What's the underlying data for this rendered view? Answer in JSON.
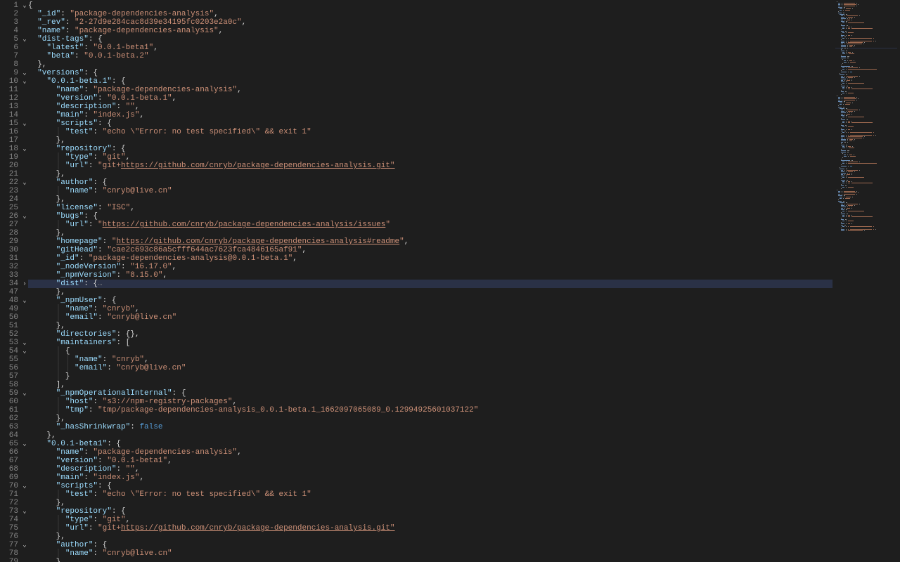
{
  "file_content": {
    "_id": "package-dependencies-analysis",
    "_rev": "2-27d9e284cac8d39e34195fc0203e2a0c",
    "name": "package-dependencies-analysis",
    "dist-tags": {
      "latest": "0.0.1-beta1",
      "beta": "0.0.1-beta.2"
    },
    "versions": {
      "0.0.1-beta.1": {
        "name": "package-dependencies-analysis",
        "version": "0.0.1-beta.1",
        "description": "",
        "main": "index.js",
        "scripts": {
          "test": "echo \\\"Error: no test specified\\\" && exit 1"
        },
        "repository": {
          "type": "git",
          "url": "git+https://github.com/cnryb/package-dependencies-analysis.git",
          "url_prefix": "git+",
          "url_link": "https://github.com/cnryb/package-dependencies-analysis.git"
        },
        "author": {
          "name": "cnryb@live.cn"
        },
        "license": "ISC",
        "bugs": {
          "url": "https://github.com/cnryb/package-dependencies-analysis/issues"
        },
        "homepage": "https://github.com/cnryb/package-dependencies-analysis#readme",
        "gitHead": "cae2c693c86a5cfff644ac7623fca4846165af91",
        "_id": "package-dependencies-analysis@0.0.1-beta.1",
        "_nodeVersion": "16.17.0",
        "_npmVersion": "8.15.0",
        "dist_folded": true,
        "_npmUser": {
          "name": "cnryb",
          "email": "cnryb@live.cn"
        },
        "directories": {},
        "maintainers": [
          {
            "name": "cnryb",
            "email": "cnryb@live.cn"
          }
        ],
        "_npmOperationalInternal": {
          "host": "s3://npm-registry-packages",
          "tmp": "tmp/package-dependencies-analysis_0.0.1-beta.1_1662097065089_0.12994925601037122"
        },
        "_hasShrinkwrap": false
      },
      "0.0.1-beta1": {
        "name": "package-dependencies-analysis",
        "version": "0.0.1-beta1",
        "description": "",
        "main": "index.js",
        "scripts": {
          "test": "echo \\\"Error: no test specified\\\" && exit 1"
        },
        "repository": {
          "type": "git",
          "url": "git+https://github.com/cnryb/package-dependencies-analysis.git",
          "url_prefix": "git+",
          "url_link": "https://github.com/cnryb/package-dependencies-analysis.git"
        },
        "author": {
          "name": "cnryb@live.cn"
        }
      }
    }
  },
  "editor": {
    "current_line_highlight": 34,
    "folded_regions": [
      {
        "start": 34,
        "end": 47,
        "display": "dist"
      }
    ],
    "colors": {
      "background": "#1e1e1e",
      "gutter_fg": "#858585",
      "key": "#9cdcfe",
      "string": "#ce9178",
      "punctuation": "#d4d4d4",
      "boolean": "#569cd6",
      "highlight_bg": "#2a3146"
    }
  },
  "lines": [
    {
      "n": 1,
      "fold": "open",
      "i": 0,
      "t": [
        [
          "p",
          "{"
        ]
      ]
    },
    {
      "n": 2,
      "i": 1,
      "t": [
        [
          "k",
          "\"_id\""
        ],
        [
          "p",
          ": "
        ],
        [
          "s",
          "\"package-dependencies-analysis\""
        ],
        [
          "p",
          ","
        ]
      ]
    },
    {
      "n": 3,
      "i": 1,
      "t": [
        [
          "k",
          "\"_rev\""
        ],
        [
          "p",
          ": "
        ],
        [
          "s",
          "\"2-27d9e284cac8d39e34195fc0203e2a0c\""
        ],
        [
          "p",
          ","
        ]
      ]
    },
    {
      "n": 4,
      "i": 1,
      "t": [
        [
          "k",
          "\"name\""
        ],
        [
          "p",
          ": "
        ],
        [
          "s",
          "\"package-dependencies-analysis\""
        ],
        [
          "p",
          ","
        ]
      ]
    },
    {
      "n": 5,
      "fold": "open",
      "i": 1,
      "t": [
        [
          "k",
          "\"dist-tags\""
        ],
        [
          "p",
          ": {"
        ]
      ]
    },
    {
      "n": 6,
      "i": 2,
      "t": [
        [
          "k",
          "\"latest\""
        ],
        [
          "p",
          ": "
        ],
        [
          "s",
          "\"0.0.1-beta1\""
        ],
        [
          "p",
          ","
        ]
      ]
    },
    {
      "n": 7,
      "i": 2,
      "t": [
        [
          "k",
          "\"beta\""
        ],
        [
          "p",
          ": "
        ],
        [
          "s",
          "\"0.0.1-beta.2\""
        ]
      ]
    },
    {
      "n": 8,
      "i": 1,
      "t": [
        [
          "p",
          "},"
        ]
      ]
    },
    {
      "n": 9,
      "fold": "open",
      "i": 1,
      "t": [
        [
          "k",
          "\"versions\""
        ],
        [
          "p",
          ": {"
        ]
      ]
    },
    {
      "n": 10,
      "fold": "open",
      "i": 2,
      "t": [
        [
          "k",
          "\"0.0.1-beta.1\""
        ],
        [
          "p",
          ": {"
        ]
      ]
    },
    {
      "n": 11,
      "i": 3,
      "t": [
        [
          "k",
          "\"name\""
        ],
        [
          "p",
          ": "
        ],
        [
          "s",
          "\"package-dependencies-analysis\""
        ],
        [
          "p",
          ","
        ]
      ]
    },
    {
      "n": 12,
      "i": 3,
      "t": [
        [
          "k",
          "\"version\""
        ],
        [
          "p",
          ": "
        ],
        [
          "s",
          "\"0.0.1-beta.1\""
        ],
        [
          "p",
          ","
        ]
      ]
    },
    {
      "n": 13,
      "i": 3,
      "t": [
        [
          "k",
          "\"description\""
        ],
        [
          "p",
          ": "
        ],
        [
          "s",
          "\"\""
        ],
        [
          "p",
          ","
        ]
      ]
    },
    {
      "n": 14,
      "i": 3,
      "t": [
        [
          "k",
          "\"main\""
        ],
        [
          "p",
          ": "
        ],
        [
          "s",
          "\"index.js\""
        ],
        [
          "p",
          ","
        ]
      ]
    },
    {
      "n": 15,
      "fold": "open",
      "i": 3,
      "t": [
        [
          "k",
          "\"scripts\""
        ],
        [
          "p",
          ": {"
        ]
      ]
    },
    {
      "n": 16,
      "i": 4,
      "g": 1,
      "t": [
        [
          "k",
          "\"test\""
        ],
        [
          "p",
          ": "
        ],
        [
          "s",
          "\"echo \\\"Error: no test specified\\\" && exit 1\""
        ]
      ]
    },
    {
      "n": 17,
      "i": 3,
      "t": [
        [
          "p",
          "},"
        ]
      ]
    },
    {
      "n": 18,
      "fold": "open",
      "i": 3,
      "t": [
        [
          "k",
          "\"repository\""
        ],
        [
          "p",
          ": {"
        ]
      ]
    },
    {
      "n": 19,
      "i": 4,
      "g": 1,
      "t": [
        [
          "k",
          "\"type\""
        ],
        [
          "p",
          ": "
        ],
        [
          "s",
          "\"git\""
        ],
        [
          "p",
          ","
        ]
      ]
    },
    {
      "n": 20,
      "i": 4,
      "g": 1,
      "t": [
        [
          "k",
          "\"url\""
        ],
        [
          "p",
          ": "
        ],
        [
          "s",
          "\"git+"
        ],
        [
          "u",
          "https://github.com/cnryb/package-dependencies-analysis.git\""
        ]
      ]
    },
    {
      "n": 21,
      "i": 3,
      "t": [
        [
          "p",
          "},"
        ]
      ]
    },
    {
      "n": 22,
      "fold": "open",
      "i": 3,
      "t": [
        [
          "k",
          "\"author\""
        ],
        [
          "p",
          ": {"
        ]
      ]
    },
    {
      "n": 23,
      "i": 4,
      "g": 1,
      "t": [
        [
          "k",
          "\"name\""
        ],
        [
          "p",
          ": "
        ],
        [
          "s",
          "\"cnryb@live.cn\""
        ]
      ]
    },
    {
      "n": 24,
      "i": 3,
      "t": [
        [
          "p",
          "},"
        ]
      ]
    },
    {
      "n": 25,
      "i": 3,
      "t": [
        [
          "k",
          "\"license\""
        ],
        [
          "p",
          ": "
        ],
        [
          "s",
          "\"ISC\""
        ],
        [
          "p",
          ","
        ]
      ]
    },
    {
      "n": 26,
      "fold": "open",
      "i": 3,
      "t": [
        [
          "k",
          "\"bugs\""
        ],
        [
          "p",
          ": {"
        ]
      ]
    },
    {
      "n": 27,
      "i": 4,
      "g": 1,
      "t": [
        [
          "k",
          "\"url\""
        ],
        [
          "p",
          ": "
        ],
        [
          "s",
          "\""
        ],
        [
          "u",
          "https://github.com/cnryb/package-dependencies-analysis/issues"
        ],
        [
          "s",
          "\""
        ]
      ]
    },
    {
      "n": 28,
      "i": 3,
      "t": [
        [
          "p",
          "},"
        ]
      ]
    },
    {
      "n": 29,
      "i": 3,
      "t": [
        [
          "k",
          "\"homepage\""
        ],
        [
          "p",
          ": "
        ],
        [
          "s",
          "\""
        ],
        [
          "u",
          "https://github.com/cnryb/package-dependencies-analysis#readme"
        ],
        [
          "s",
          "\""
        ],
        [
          "p",
          ","
        ]
      ]
    },
    {
      "n": 30,
      "i": 3,
      "t": [
        [
          "k",
          "\"gitHead\""
        ],
        [
          "p",
          ": "
        ],
        [
          "s",
          "\"cae2c693c86a5cfff644ac7623fca4846165af91\""
        ],
        [
          "p",
          ","
        ]
      ]
    },
    {
      "n": 31,
      "i": 3,
      "t": [
        [
          "k",
          "\"_id\""
        ],
        [
          "p",
          ": "
        ],
        [
          "s",
          "\"package-dependencies-analysis@0.0.1-beta.1\""
        ],
        [
          "p",
          ","
        ]
      ]
    },
    {
      "n": 32,
      "i": 3,
      "t": [
        [
          "k",
          "\"_nodeVersion\""
        ],
        [
          "p",
          ": "
        ],
        [
          "s",
          "\"16.17.0\""
        ],
        [
          "p",
          ","
        ]
      ]
    },
    {
      "n": 33,
      "i": 3,
      "t": [
        [
          "k",
          "\"_npmVersion\""
        ],
        [
          "p",
          ": "
        ],
        [
          "s",
          "\"8.15.0\""
        ],
        [
          "p",
          ","
        ]
      ]
    },
    {
      "n": 34,
      "fold": "collapsed",
      "hl": true,
      "i": 3,
      "t": [
        [
          "k",
          "\"dist\""
        ],
        [
          "p",
          ": {"
        ],
        [
          "dots",
          "…"
        ]
      ]
    },
    {
      "n": 47,
      "i": 3,
      "t": [
        [
          "p",
          "},"
        ]
      ]
    },
    {
      "n": 48,
      "fold": "open",
      "i": 3,
      "t": [
        [
          "k",
          "\"_npmUser\""
        ],
        [
          "p",
          ": {"
        ]
      ]
    },
    {
      "n": 49,
      "i": 4,
      "g": 1,
      "t": [
        [
          "k",
          "\"name\""
        ],
        [
          "p",
          ": "
        ],
        [
          "s",
          "\"cnryb\""
        ],
        [
          "p",
          ","
        ]
      ]
    },
    {
      "n": 50,
      "i": 4,
      "g": 1,
      "t": [
        [
          "k",
          "\"email\""
        ],
        [
          "p",
          ": "
        ],
        [
          "s",
          "\"cnryb@live.cn\""
        ]
      ]
    },
    {
      "n": 51,
      "i": 3,
      "t": [
        [
          "p",
          "},"
        ]
      ]
    },
    {
      "n": 52,
      "i": 3,
      "t": [
        [
          "k",
          "\"directories\""
        ],
        [
          "p",
          ": {},"
        ]
      ]
    },
    {
      "n": 53,
      "fold": "open",
      "i": 3,
      "t": [
        [
          "k",
          "\"maintainers\""
        ],
        [
          "p",
          ": ["
        ]
      ]
    },
    {
      "n": 54,
      "fold": "open",
      "i": 4,
      "g": 1,
      "t": [
        [
          "p",
          "{"
        ]
      ]
    },
    {
      "n": 55,
      "i": 5,
      "g": 2,
      "t": [
        [
          "k",
          "\"name\""
        ],
        [
          "p",
          ": "
        ],
        [
          "s",
          "\"cnryb\""
        ],
        [
          "p",
          ","
        ]
      ]
    },
    {
      "n": 56,
      "i": 5,
      "g": 2,
      "t": [
        [
          "k",
          "\"email\""
        ],
        [
          "p",
          ": "
        ],
        [
          "s",
          "\"cnryb@live.cn\""
        ]
      ]
    },
    {
      "n": 57,
      "i": 4,
      "g": 1,
      "t": [
        [
          "p",
          "}"
        ]
      ]
    },
    {
      "n": 58,
      "i": 3,
      "t": [
        [
          "p",
          "],"
        ]
      ]
    },
    {
      "n": 59,
      "fold": "open",
      "i": 3,
      "t": [
        [
          "k",
          "\"_npmOperationalInternal\""
        ],
        [
          "p",
          ": {"
        ]
      ]
    },
    {
      "n": 60,
      "i": 4,
      "g": 1,
      "t": [
        [
          "k",
          "\"host\""
        ],
        [
          "p",
          ": "
        ],
        [
          "s",
          "\"s3://npm-registry-packages\""
        ],
        [
          "p",
          ","
        ]
      ]
    },
    {
      "n": 61,
      "i": 4,
      "g": 1,
      "t": [
        [
          "k",
          "\"tmp\""
        ],
        [
          "p",
          ": "
        ],
        [
          "s",
          "\"tmp/package-dependencies-analysis_0.0.1-beta.1_1662097065089_0.12994925601037122\""
        ]
      ]
    },
    {
      "n": 62,
      "i": 3,
      "t": [
        [
          "p",
          "},"
        ]
      ]
    },
    {
      "n": 63,
      "i": 3,
      "t": [
        [
          "k",
          "\"_hasShrinkwrap\""
        ],
        [
          "p",
          ": "
        ],
        [
          "b",
          "false"
        ]
      ]
    },
    {
      "n": 64,
      "i": 2,
      "t": [
        [
          "p",
          "},"
        ]
      ]
    },
    {
      "n": 65,
      "fold": "open",
      "i": 2,
      "t": [
        [
          "k",
          "\"0.0.1-beta1\""
        ],
        [
          "p",
          ": {"
        ]
      ]
    },
    {
      "n": 66,
      "i": 3,
      "t": [
        [
          "k",
          "\"name\""
        ],
        [
          "p",
          ": "
        ],
        [
          "s",
          "\"package-dependencies-analysis\""
        ],
        [
          "p",
          ","
        ]
      ]
    },
    {
      "n": 67,
      "i": 3,
      "t": [
        [
          "k",
          "\"version\""
        ],
        [
          "p",
          ": "
        ],
        [
          "s",
          "\"0.0.1-beta1\""
        ],
        [
          "p",
          ","
        ]
      ]
    },
    {
      "n": 68,
      "i": 3,
      "t": [
        [
          "k",
          "\"description\""
        ],
        [
          "p",
          ": "
        ],
        [
          "s",
          "\"\""
        ],
        [
          "p",
          ","
        ]
      ]
    },
    {
      "n": 69,
      "i": 3,
      "t": [
        [
          "k",
          "\"main\""
        ],
        [
          "p",
          ": "
        ],
        [
          "s",
          "\"index.js\""
        ],
        [
          "p",
          ","
        ]
      ]
    },
    {
      "n": 70,
      "fold": "open",
      "i": 3,
      "t": [
        [
          "k",
          "\"scripts\""
        ],
        [
          "p",
          ": {"
        ]
      ]
    },
    {
      "n": 71,
      "i": 4,
      "g": 1,
      "t": [
        [
          "k",
          "\"test\""
        ],
        [
          "p",
          ": "
        ],
        [
          "s",
          "\"echo \\\"Error: no test specified\\\" && exit 1\""
        ]
      ]
    },
    {
      "n": 72,
      "i": 3,
      "t": [
        [
          "p",
          "},"
        ]
      ]
    },
    {
      "n": 73,
      "fold": "open",
      "i": 3,
      "t": [
        [
          "k",
          "\"repository\""
        ],
        [
          "p",
          ": {"
        ]
      ]
    },
    {
      "n": 74,
      "i": 4,
      "g": 1,
      "t": [
        [
          "k",
          "\"type\""
        ],
        [
          "p",
          ": "
        ],
        [
          "s",
          "\"git\""
        ],
        [
          "p",
          ","
        ]
      ]
    },
    {
      "n": 75,
      "i": 4,
      "g": 1,
      "t": [
        [
          "k",
          "\"url\""
        ],
        [
          "p",
          ": "
        ],
        [
          "s",
          "\"git+"
        ],
        [
          "u",
          "https://github.com/cnryb/package-dependencies-analysis.git\""
        ]
      ]
    },
    {
      "n": 76,
      "i": 3,
      "t": [
        [
          "p",
          "},"
        ]
      ]
    },
    {
      "n": 77,
      "fold": "open",
      "i": 3,
      "t": [
        [
          "k",
          "\"author\""
        ],
        [
          "p",
          ": {"
        ]
      ]
    },
    {
      "n": 78,
      "i": 4,
      "g": 1,
      "t": [
        [
          "k",
          "\"name\""
        ],
        [
          "p",
          ": "
        ],
        [
          "s",
          "\"cnryb@live.cn\""
        ]
      ]
    },
    {
      "n": 79,
      "i": 3,
      "t": [
        [
          "p",
          "},"
        ]
      ]
    }
  ]
}
